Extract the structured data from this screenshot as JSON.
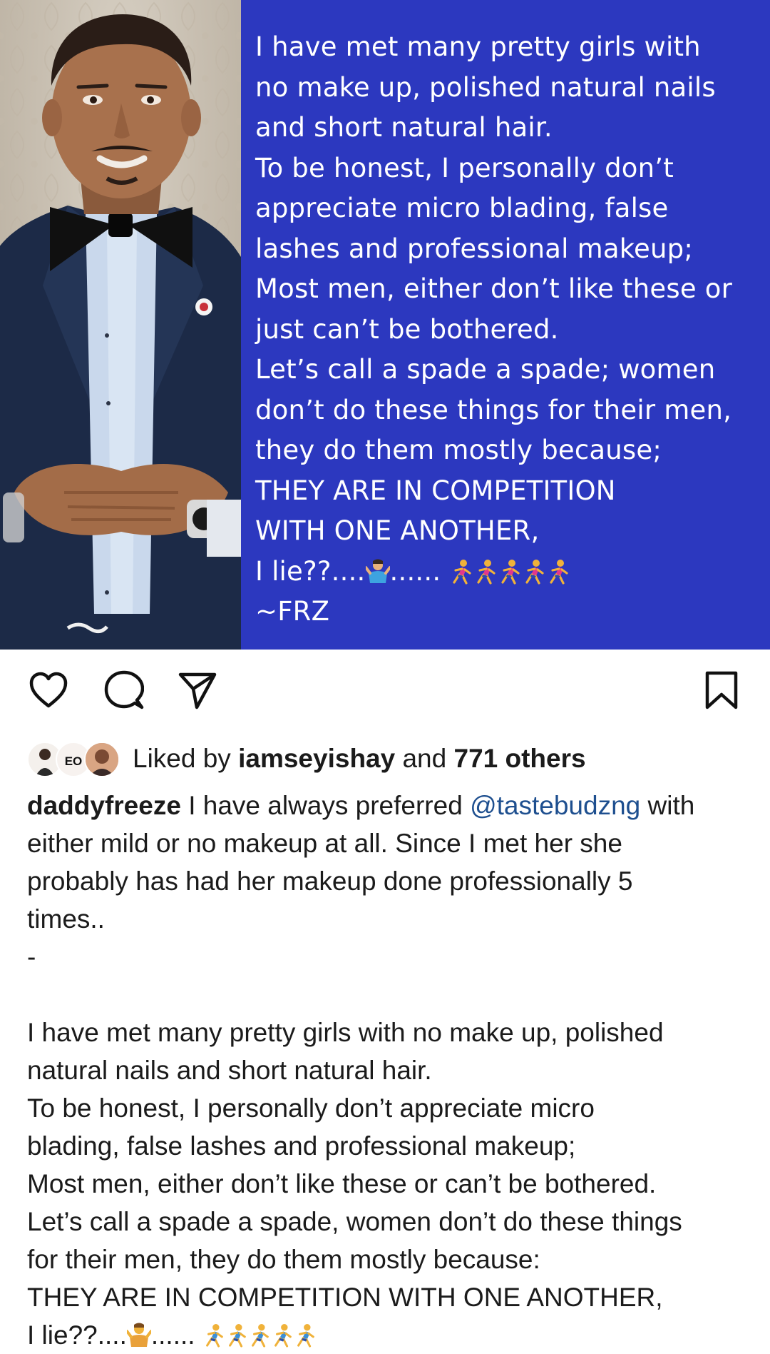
{
  "post": {
    "quote_lines": [
      "I have met many pretty girls with",
      "no make up, polished natural nails",
      "and short natural hair.",
      "To be honest, I personally don’t",
      "appreciate micro blading, false",
      "lashes and professional makeup;",
      "Most men, either don’t like these or",
      "just can’t be bothered.",
      "Let’s call a spade a spade; women",
      "don’t do these things for their men,",
      "they do them mostly because;",
      "THEY ARE IN COMPETITION",
      "WITH ONE ANOTHER,"
    ],
    "quote_lie_prefix": "I lie??....",
    "quote_lie_dots": "......",
    "quote_signature": "~FRZ",
    "quote_bg_color": "#2c38bf",
    "emoji_runner_count": 5
  },
  "actions": {
    "like_icon": "heart-icon",
    "comment_icon": "comment-icon",
    "share_icon": "send-icon",
    "save_icon": "bookmark-icon"
  },
  "likes": {
    "prefix": "Liked by ",
    "user": "iamseyishay",
    "middle": " and ",
    "others": "771 others",
    "avatar_badge": "EO"
  },
  "caption": {
    "username": "daddyfreeze",
    "intro_before_mention": " I have always preferred ",
    "mention": "@tastebudzng",
    "intro_after_mention": " with",
    "intro_lines": [
      "either mild or no makeup at all. Since I met her she",
      "probably has had her makeup done professionally 5",
      "times.."
    ],
    "separator": "-",
    "body_lines": [
      "I have met many pretty girls with no make up, polished",
      "natural nails and short natural hair.",
      "To be honest, I personally don’t appreciate micro",
      "blading, false lashes and professional makeup;",
      "Most men, either don’t like these or can’t be bothered.",
      "Let’s call a spade a spade, women don’t do these things",
      "for their men, they do them mostly because:",
      "THEY ARE IN COMPETITION WITH ONE ANOTHER,"
    ],
    "lie_prefix": "I lie??....",
    "lie_dots": "......"
  }
}
